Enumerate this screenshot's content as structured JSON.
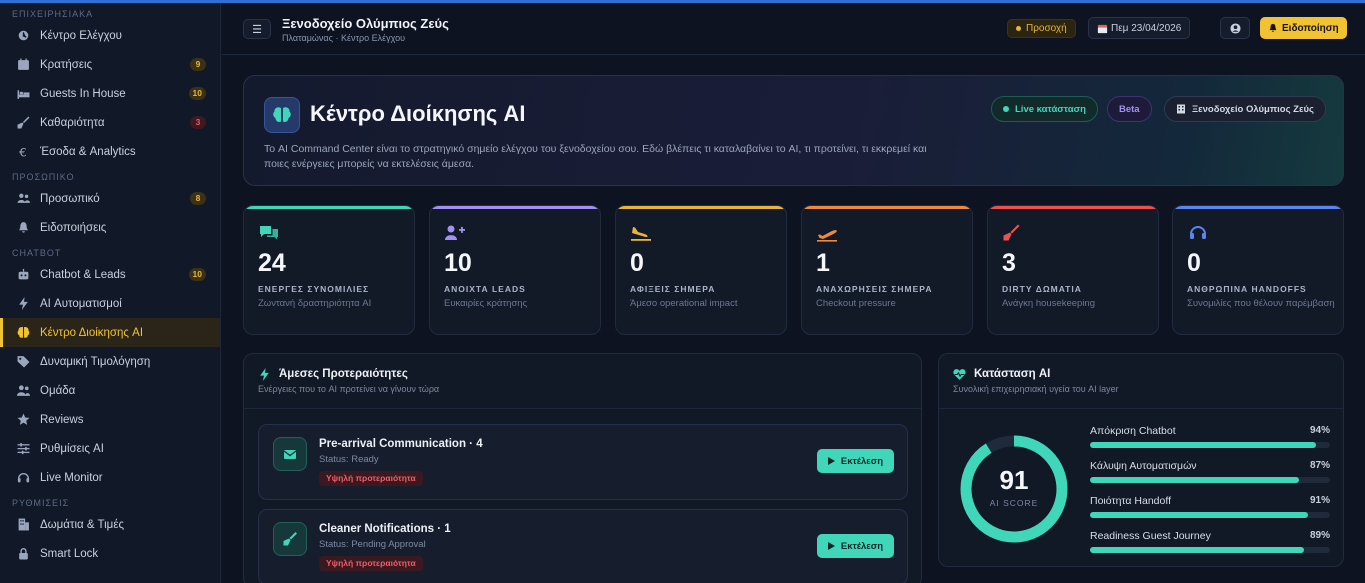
{
  "sidebar": {
    "sections": [
      {
        "title": "ΕΠΙΧΕΙΡΗΣΙΑΚΑ",
        "items": [
          {
            "label": "Κέντρο Ελέγχου",
            "icon": "dashboard-icon"
          },
          {
            "label": "Κρατήσεις",
            "icon": "calendar-icon",
            "badge": "9",
            "badge_color": "amber"
          },
          {
            "label": "Guests In House",
            "icon": "bed-icon",
            "badge": "10",
            "badge_color": "amber"
          },
          {
            "label": "Καθαριότητα",
            "icon": "broom-icon",
            "badge": "3",
            "badge_color": "red"
          },
          {
            "label": "Έσοδα & Analytics",
            "icon": "euro-icon"
          }
        ]
      },
      {
        "title": "ΠΡΟΣΩΠΙΚΟ",
        "items": [
          {
            "label": "Προσωπικό",
            "icon": "users-icon",
            "badge": "8",
            "badge_color": "amber"
          },
          {
            "label": "Ειδοποιήσεις",
            "icon": "bell-icon"
          }
        ]
      },
      {
        "title": "CHATBOT",
        "items": [
          {
            "label": "Chatbot & Leads",
            "icon": "robot-icon",
            "badge": "10",
            "badge_color": "amber"
          },
          {
            "label": "AI Αυτοματισμοί",
            "icon": "bolt-icon"
          },
          {
            "label": "Κέντρο Διοίκησης AI",
            "icon": "brain-icon",
            "active": true
          },
          {
            "label": "Δυναμική Τιμολόγηση",
            "icon": "tag-icon"
          },
          {
            "label": "Ομάδα",
            "icon": "team-icon"
          },
          {
            "label": "Reviews",
            "icon": "star-icon"
          },
          {
            "label": "Ρυθμίσεις AI",
            "icon": "sliders-icon"
          },
          {
            "label": "Live Monitor",
            "icon": "headset-icon"
          }
        ]
      },
      {
        "title": "ΡΥΘΜΙΣΕΙΣ",
        "items": [
          {
            "label": "Δωμάτια & Τιμές",
            "icon": "building-icon"
          },
          {
            "label": "Smart Lock",
            "icon": "lock-icon"
          }
        ]
      }
    ]
  },
  "header": {
    "title": "Ξενοδοχείο Ολύμπιος Ζεύς",
    "subtitle": "Πλαταμώνας · Κέντρο Ελέγχου",
    "attention_label": "Προσοχή",
    "date_label": "Πεμ 23/04/2026",
    "notification_label": "Ειδοποίηση"
  },
  "hero": {
    "title": "Κέντρο Διοίκησης AI",
    "description": "Το AI Command Center είναι το στρατηγικό σημείο ελέγχου του ξενοδοχείου σου. Εδώ βλέπεις τι καταλαβαίνει το AI, τι προτείνει, τι εκκρεμεί και ποιες ενέργειες μπορείς να εκτελέσεις άμεσα.",
    "live_label": "Live κατάσταση",
    "beta_label": "Beta",
    "hotel_label": "Ξενοδοχείο Ολύμπιος Ζεύς"
  },
  "stats": [
    {
      "value": "24",
      "label": "ΕΝΕΡΓΕΣ ΣΥΝΟΜΙΛΙΕΣ",
      "sub": "Ζωντανή δραστηριότητα AI",
      "color": "#3fd6b9",
      "icon": "chat-icon"
    },
    {
      "value": "10",
      "label": "ΑΝΟΙΧΤΑ LEADS",
      "sub": "Ευκαιρίες κράτησης",
      "color": "#a390f5",
      "icon": "user-plus-icon"
    },
    {
      "value": "0",
      "label": "ΑΦΙΞΕΙΣ ΣΗΜΕΡΑ",
      "sub": "Άμεσο operational impact",
      "color": "#e8b53a",
      "icon": "plane-landing-icon"
    },
    {
      "value": "1",
      "label": "ΑΝΑΧΩΡΗΣΕΙΣ ΣΗΜΕΡΑ",
      "sub": "Checkout pressure",
      "color": "#f08a3a",
      "icon": "plane-departure-icon"
    },
    {
      "value": "3",
      "label": "DIRTY ΔΩΜΑΤΙΑ",
      "sub": "Ανάγκη housekeeping",
      "color": "#ef4f4f",
      "icon": "broom-icon"
    },
    {
      "value": "0",
      "label": "ΑΝΘΡΩΠΙΝΑ HANDOFFS",
      "sub": "Συνομιλίες που θέλουν παρέμβαση",
      "color": "#5b84f0",
      "icon": "headset-icon"
    }
  ],
  "priorities": {
    "title": "Άμεσες Προτεραιότητες",
    "subtitle": "Ενέργειες που το AI προτείνει να γίνουν τώρα",
    "tasks": [
      {
        "title": "Pre-arrival Communication · 4",
        "status": "Status: Ready",
        "badge": "Υψηλή προτεραιότητα",
        "button": "Εκτέλεση",
        "icon": "envelope-icon"
      },
      {
        "title": "Cleaner Notifications · 1",
        "status": "Status: Pending Approval",
        "badge": "Υψηλή προτεραιότητα",
        "button": "Εκτέλεση",
        "icon": "broom-icon"
      }
    ]
  },
  "ai_status": {
    "title": "Κατάσταση AI",
    "subtitle": "Συνολική επιχειρησιακή υγεία του AI layer",
    "score": "91",
    "score_fraction": 0.91,
    "score_label": "AI SCORE",
    "metrics": [
      {
        "name": "Απόκριση Chatbot",
        "value": "94%",
        "fraction": 0.94
      },
      {
        "name": "Κάλυψη Αυτοματισμών",
        "value": "87%",
        "fraction": 0.87
      },
      {
        "name": "Ποιότητα Handoff",
        "value": "91%",
        "fraction": 0.91
      },
      {
        "name": "Readiness Guest Journey",
        "value": "89%",
        "fraction": 0.89
      }
    ]
  }
}
